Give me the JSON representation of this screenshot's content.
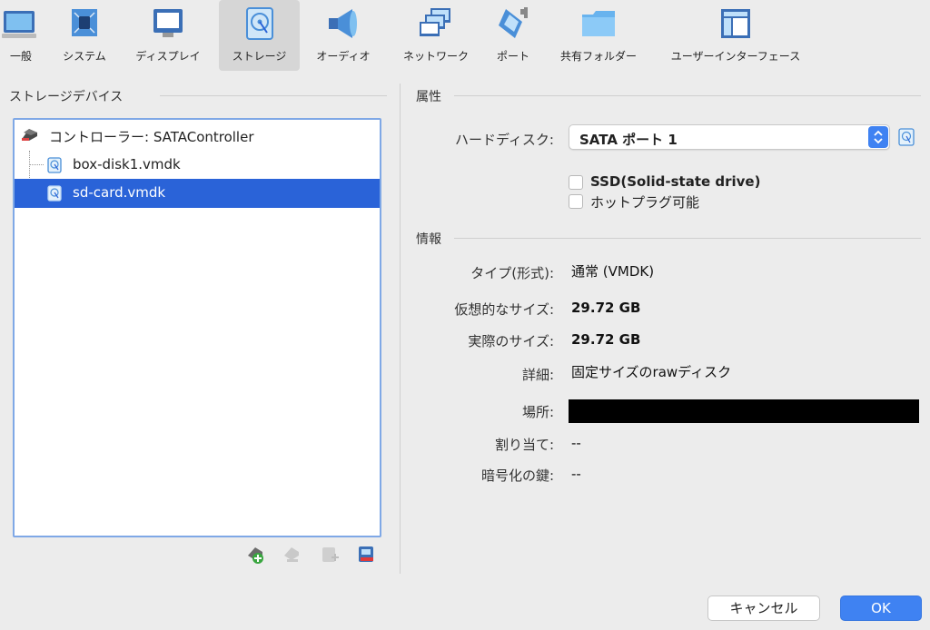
{
  "toolbar": {
    "items": [
      {
        "label": "一般",
        "icon": "monitor-general-icon"
      },
      {
        "label": "システム",
        "icon": "chip-icon"
      },
      {
        "label": "ディスプレイ",
        "icon": "display-icon"
      },
      {
        "label": "ストレージ",
        "icon": "storage-disk-icon"
      },
      {
        "label": "オーディオ",
        "icon": "speaker-icon"
      },
      {
        "label": "ネットワーク",
        "icon": "network-icon"
      },
      {
        "label": "ポート",
        "icon": "serial-port-icon"
      },
      {
        "label": "共有フォルダー",
        "icon": "shared-folder-icon"
      },
      {
        "label": "ユーザーインターフェース",
        "icon": "user-interface-icon"
      }
    ],
    "active_index": 3
  },
  "storage_devices": {
    "title": "ストレージデバイス",
    "controller_label": "コントローラー: SATAController",
    "disks": [
      {
        "label": "box-disk1.vmdk",
        "selected": false
      },
      {
        "label": "sd-card.vmdk",
        "selected": true
      }
    ]
  },
  "attributes": {
    "title": "属性",
    "hard_disk_label": "ハードディスク:",
    "hard_disk_value": "SATA ポート 1",
    "ssd_label": "SSD(Solid-state drive)",
    "ssd_checked": false,
    "hotplug_label": "ホットプラグ可能",
    "hotplug_checked": false
  },
  "info": {
    "title": "情報",
    "type_label": "タイプ(形式):",
    "type_value": "通常 (VMDK)",
    "virtual_size_label": "仮想的なサイズ:",
    "virtual_size_value": "29.72 GB",
    "actual_size_label": "実際のサイズ:",
    "actual_size_value": "29.72 GB",
    "details_label": "詳細:",
    "details_value": "固定サイズのrawディスク",
    "location_label": "場所:",
    "attached_label": "割り当て:",
    "attached_value": "--",
    "encryption_label": "暗号化の鍵:",
    "encryption_value": "--"
  },
  "buttons": {
    "cancel": "キャンセル",
    "ok": "OK"
  },
  "colors": {
    "accent": "#3f82f2",
    "selection": "#2a63d8"
  }
}
